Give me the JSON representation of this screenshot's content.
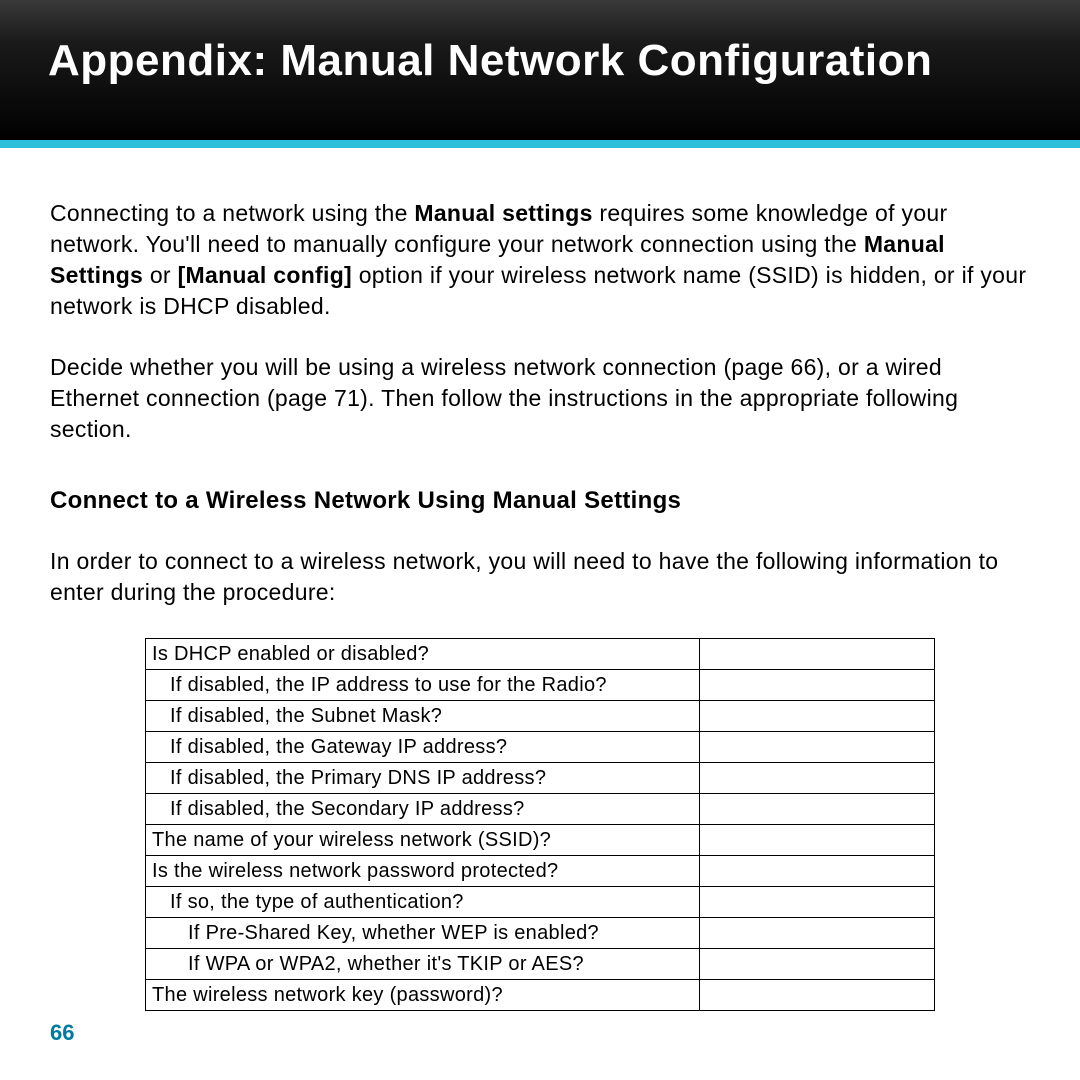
{
  "header": {
    "title": "Appendix: Manual Network Configuration"
  },
  "intro": {
    "p1_a": "Connecting to a network using the ",
    "p1_b": "Manual settings",
    "p1_c": " requires some knowledge of your network. You'll need to manually configure your network connection using the ",
    "p1_d": "Manual Settings",
    "p1_e": " or ",
    "p1_f": "[Manual config]",
    "p1_g": " option if your wireless network name (SSID) is hidden, or if your network is DHCP disabled.",
    "p2": "Decide whether you will be using a wireless network connection (page 66), or a wired Ethernet connection (page 71). Then follow the instructions in the appropriate following section."
  },
  "section": {
    "heading": "Connect to a Wireless Network Using Manual Settings",
    "intro": "In order to connect to a wireless network, you will need to have the following information to enter during the procedure:"
  },
  "table": {
    "rows": [
      {
        "q": "Is DHCP enabled or disabled?",
        "indent": 0
      },
      {
        "q": "If disabled, the IP address to use for the Radio?",
        "indent": 1
      },
      {
        "q": "If disabled, the Subnet Mask?",
        "indent": 1
      },
      {
        "q": "If disabled, the Gateway IP address?",
        "indent": 1
      },
      {
        "q": "If disabled, the Primary DNS IP address?",
        "indent": 1
      },
      {
        "q": "If disabled, the Secondary IP address?",
        "indent": 1
      },
      {
        "q": "The name of your wireless network (SSID)?",
        "indent": 0
      },
      {
        "q": "Is the wireless network password protected?",
        "indent": 0
      },
      {
        "q": "If so, the type of authentication?",
        "indent": 1
      },
      {
        "q": "If Pre-Shared Key, whether WEP is enabled?",
        "indent": 2
      },
      {
        "q": "If WPA or WPA2, whether it's TKIP or AES?",
        "indent": 2
      },
      {
        "q": "The wireless network key (password)?",
        "indent": 0
      }
    ]
  },
  "page_number": "66"
}
